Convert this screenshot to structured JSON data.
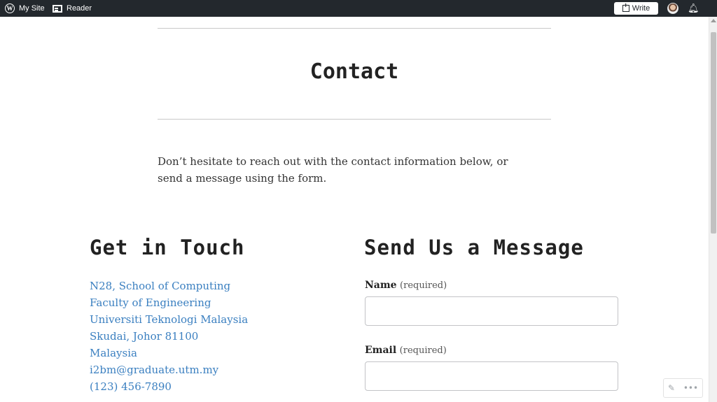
{
  "adminbar": {
    "mysite_label": "My Site",
    "reader_label": "Reader",
    "write_label": "Write"
  },
  "page": {
    "title": "Contact",
    "intro": "Don’t hesitate to reach out with the contact information below, or send a message using the form."
  },
  "get_in_touch": {
    "heading": "Get in Touch",
    "lines": [
      "N28, School of Computing",
      "Faculty of Engineering",
      "Universiti Teknologi Malaysia",
      "Skudai, Johor 81100",
      "Malaysia",
      "i2bm@graduate.utm.my",
      "(123) 456-7890"
    ]
  },
  "form": {
    "heading": "Send Us a Message",
    "name_label": "Name",
    "name_required": "(required)",
    "name_value": "",
    "email_label": "Email",
    "email_required": "(required)",
    "email_value": ""
  },
  "colors": {
    "adminbar_bg": "#23282d",
    "link": "#3a7fc0"
  },
  "icons": [
    "wordpress-logo-icon",
    "reader-icon",
    "write-icon",
    "avatar",
    "notifications-icon",
    "pencil-icon",
    "more-icon"
  ]
}
